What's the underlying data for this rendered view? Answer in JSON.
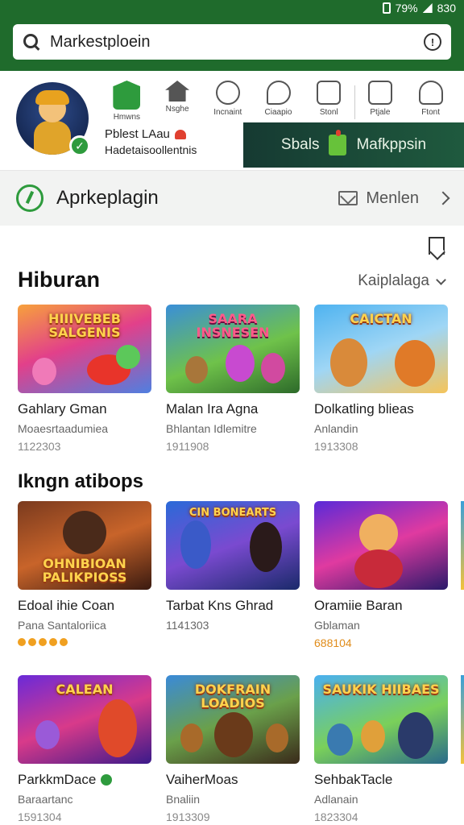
{
  "status": {
    "time": "79%",
    "battery_text": "830"
  },
  "search": {
    "value": "Markestploein"
  },
  "nav": [
    {
      "label": "Hmwns",
      "icon": "store-icon"
    },
    {
      "label": "Nsghe",
      "icon": "home-icon"
    },
    {
      "label": "Incnaint",
      "icon": "clock-icon"
    },
    {
      "label": "Ciaapio",
      "icon": "chat-icon"
    },
    {
      "label": "Stonl",
      "icon": "portrait-icon"
    },
    {
      "label": "Ptjale",
      "icon": "edit-icon"
    },
    {
      "label": "Ftont",
      "icon": "person-icon"
    }
  ],
  "profile": {
    "name": "Pblest LAau",
    "subtitle": "Hadetaisoollentnis"
  },
  "banner": {
    "left": "Sbals",
    "right": "Mafkppsin"
  },
  "header": {
    "title": "Aprkeplagin",
    "menu": "Menlen"
  },
  "section1": {
    "title": "Hiburan",
    "filter": "Kaiplalaga"
  },
  "section2": {
    "title": "Ikngn atibops"
  },
  "row1": [
    {
      "thumb": "HIIIVEBEB SALGENIS",
      "title": "Gahlary Gman",
      "sub": "Moaesrtaadumiea",
      "meta": "1122303"
    },
    {
      "thumb": "SAARA INSNESEN",
      "title": "Malan Ira Agna",
      "sub": "Bhlantan Idlemitre",
      "meta": "1911908"
    },
    {
      "thumb": "CAICTAN",
      "title": "Dolkatling blieas",
      "sub": "Anlandin",
      "meta": "1913308"
    }
  ],
  "row2": [
    {
      "thumb": "OHNIBIOAN PALIKPIOSS",
      "title": "Edoal ihie Coan",
      "sub": "Pana Santaloriica",
      "meta": ""
    },
    {
      "thumb": "CIN BONEARTS",
      "title": "Tarbat Kns Ghrad",
      "sub": "1141303",
      "meta": ""
    },
    {
      "thumb": "",
      "title": "Oramiie Baran",
      "sub": "Gblaman",
      "meta": "688104"
    }
  ],
  "row3": [
    {
      "thumb": "CALEAN",
      "title": "ParkkmDace",
      "sub": "Baraartanc",
      "meta": "1591304"
    },
    {
      "thumb": "DOKFRAIN LOADIOS",
      "title": "VaiherMoas",
      "sub": "Bnaliin",
      "meta": "1913309"
    },
    {
      "thumb": "SAUKIK HIIBAES",
      "title": "SehbakTacle",
      "sub": "Adlanain",
      "meta": "1823304"
    }
  ],
  "colors": {
    "brand_green": "#1f6b2c",
    "accent_green": "#2e9b3d",
    "banner_dark": "#163a32",
    "rating_orange": "#f0a020"
  }
}
